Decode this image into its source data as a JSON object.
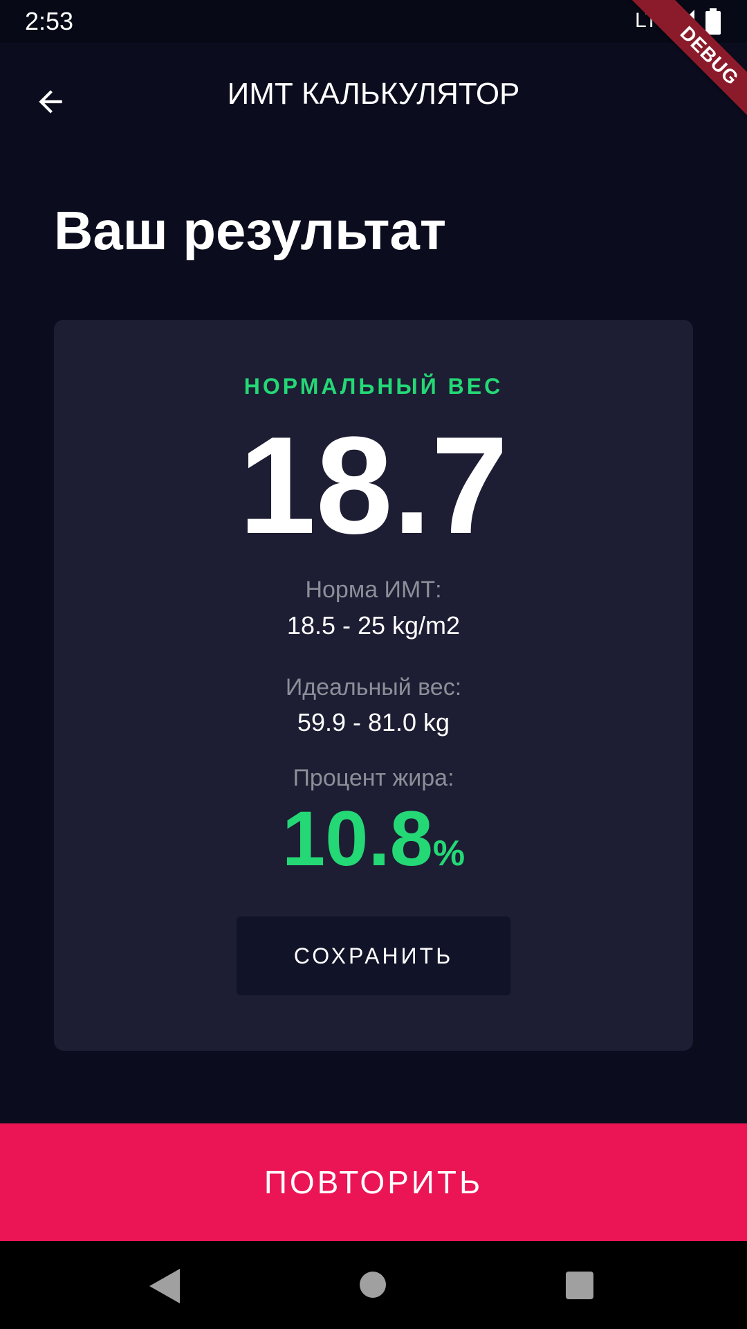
{
  "status_bar": {
    "time": "2:53",
    "network": "LTE",
    "icons": [
      "signal-icon",
      "battery-icon"
    ]
  },
  "debug_banner": "DEBUG",
  "app_bar": {
    "title": "ИМТ КАЛЬКУЛЯТОР",
    "back_icon": "arrow-back-icon"
  },
  "page": {
    "title": "Ваш результат"
  },
  "result": {
    "status": "НОРМАЛЬНЫЙ ВЕС",
    "bmi": "18.7",
    "norm_label": "Норма ИМТ:",
    "norm_value": "18.5 - 25 kg/m2",
    "ideal_label": "Идеальный вес:",
    "ideal_value": "59.9 - 81.0 kg",
    "fat_label": "Процент жира:",
    "fat_value": "10.8",
    "fat_unit": "%",
    "save_label": "СОХРАНИТЬ"
  },
  "actions": {
    "repeat_label": "ПОВТОРИТЬ"
  },
  "nav_bar": {
    "icons": [
      "nav-back-icon",
      "nav-home-icon",
      "nav-recents-icon"
    ]
  },
  "colors": {
    "background": "#0b0d1f",
    "card": "#1d1e33",
    "accent_green": "#24d876",
    "accent_pink": "#eb1555",
    "label_gray": "#8d8e98"
  }
}
